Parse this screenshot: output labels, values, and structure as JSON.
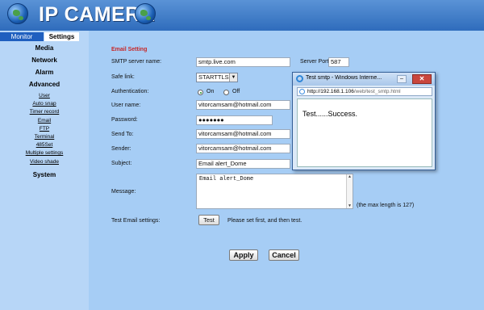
{
  "header": {
    "title": "IP CAMERA"
  },
  "tabs": [
    {
      "label": "Monitor"
    },
    {
      "label": "Settings"
    }
  ],
  "nav": {
    "media": "Media",
    "network": "Network",
    "alarm": "Alarm",
    "advanced": "Advanced",
    "sub": [
      "User",
      "Auto snap",
      "Timer record",
      "Email",
      "FTP",
      "Terminal",
      "485Set",
      "Multiple settings",
      "Video shade"
    ],
    "system": "System"
  },
  "form": {
    "section_title": "Email Setting",
    "smtp_server_label": "SMTP server name:",
    "smtp_server_value": "smtp.live.com",
    "server_port_label": "Server Port",
    "server_port_value": "587",
    "safe_link_label": "Safe link:",
    "safe_link_value": "STARTTLS",
    "auth_label": "Authentication:",
    "auth_on": "On",
    "auth_off": "Off",
    "auth_selected": "On",
    "user_name_label": "User name:",
    "user_name_value": "vitorcamsam@hotmail.com",
    "password_label": "Password:",
    "password_value": "●●●●●●●",
    "send_to_label": "Send To:",
    "send_to_value": "vitorcamsam@hotmail.com",
    "sender_label": "Sender:",
    "sender_value": "vitorcamsam@hotmail.com",
    "subject_label": "Subject:",
    "subject_value": "Email alert_Dome",
    "message_label": "Message:",
    "message_value": "Email alert_Dome",
    "max_length_note": "(the max length is 127)",
    "test_label": "Test Email settings:",
    "test_button": "Test",
    "test_hint": "Please set first, and then test.",
    "apply_button": "Apply",
    "cancel_button": "Cancel"
  },
  "popup": {
    "title": "Test smtp - Windows Interne...",
    "address_host": "http://192.168.1.106",
    "address_path": "/web/test_smtp.html",
    "message": "Test......Success."
  },
  "colors": {
    "page_bg": "#a6cdf5",
    "header_bg": "#2f6cbc",
    "section_title": "#c62828",
    "active_tab": "#1f5fbf"
  }
}
